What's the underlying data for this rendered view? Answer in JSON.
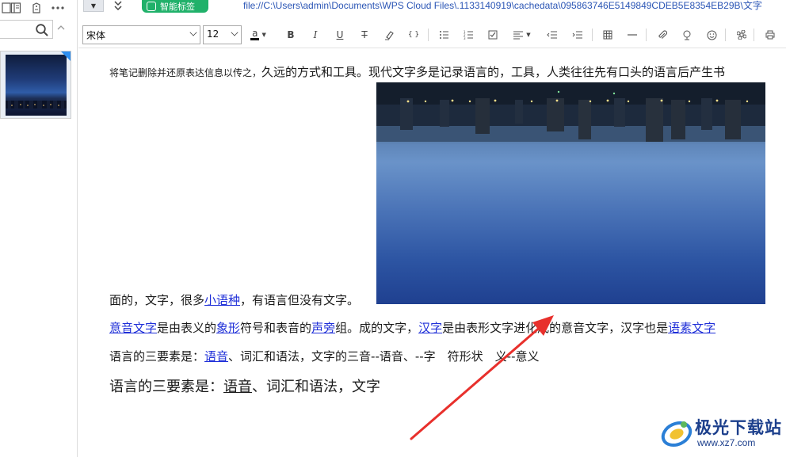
{
  "sidebar": {
    "search_placeholder": ""
  },
  "topbar": {
    "smart_tag_label": "智能标签",
    "file_path": "file://C:\\Users\\admin\\Documents\\WPS Cloud Files\\.1133140919\\cachedata\\095863746E5149849CDEB5E8354EB29B\\文字"
  },
  "toolbar": {
    "font_name": "宋体",
    "font_size": "12",
    "font_color_glyph": "a",
    "bold_glyph": "B",
    "italic_glyph": "I",
    "underline_glyph": "U",
    "strike_glyph": "T",
    "code_glyph": "{ }"
  },
  "document": {
    "line1_prefix": "将笔记删除并还原表达信息以传之，",
    "line1_text": "久远的方式和工具。现代文字多是记录语言的，工具，人类往往先有口头的语言后产生书",
    "line2_text_a": "面的，文字，很多",
    "line2_link": "小语种",
    "line2_text_b": "，有语言但没有文字。",
    "line3_link1": "意音文字",
    "line3_text_a": "是由表义的",
    "line3_link2": "象形",
    "line3_text_b": "符号和表音的",
    "line3_link3": "声旁",
    "line3_text_c": "组。成的文字，",
    "line3_link4": "汉字",
    "line3_text_d": "是由表形文字进化成的意音文字，汉字也是",
    "line3_link5": "语素文字",
    "line4_text_a": "语言的三要素是：",
    "line4_link": "语音",
    "line4_text_b": "、词汇和语法，文字的三音--语音、--字　符形状　义--意义",
    "line5_text_a": "语言的三要素是：",
    "line5_underlined": "语音",
    "line5_text_b": "、词汇和语法，文字"
  },
  "watermark": {
    "title": "极光下载站",
    "url": "www.xz7.com"
  },
  "colors": {
    "link": "#1f2fd8",
    "smart_tag": "#20b16a",
    "path": "#2a55b5",
    "arrow": "#e8302c"
  }
}
